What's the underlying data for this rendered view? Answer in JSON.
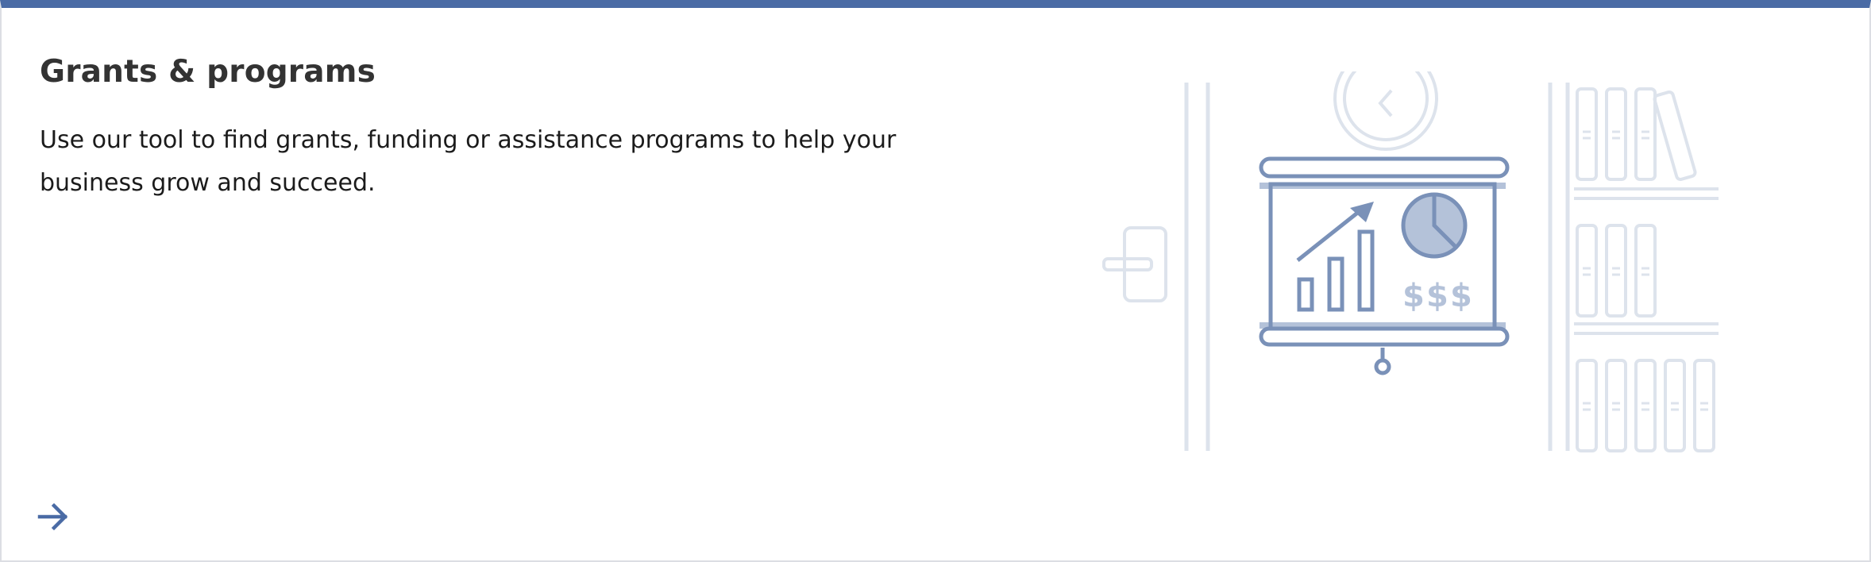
{
  "card": {
    "title": "Grants & programs",
    "description": "Use our tool to find grants, funding or assistance programs to help your business grow and succeed.",
    "link_icon": "arrow-right-icon",
    "illustration_icon": "presentation-board-illustration"
  },
  "colors": {
    "accent": "#4a6ba5",
    "border": "#dcdee3",
    "title_text": "#333333",
    "body_text": "#1b1b1b",
    "illustration_primary": "#7a91b8",
    "illustration_light": "#dde3ec",
    "illustration_fill": "#b4c2d9"
  }
}
